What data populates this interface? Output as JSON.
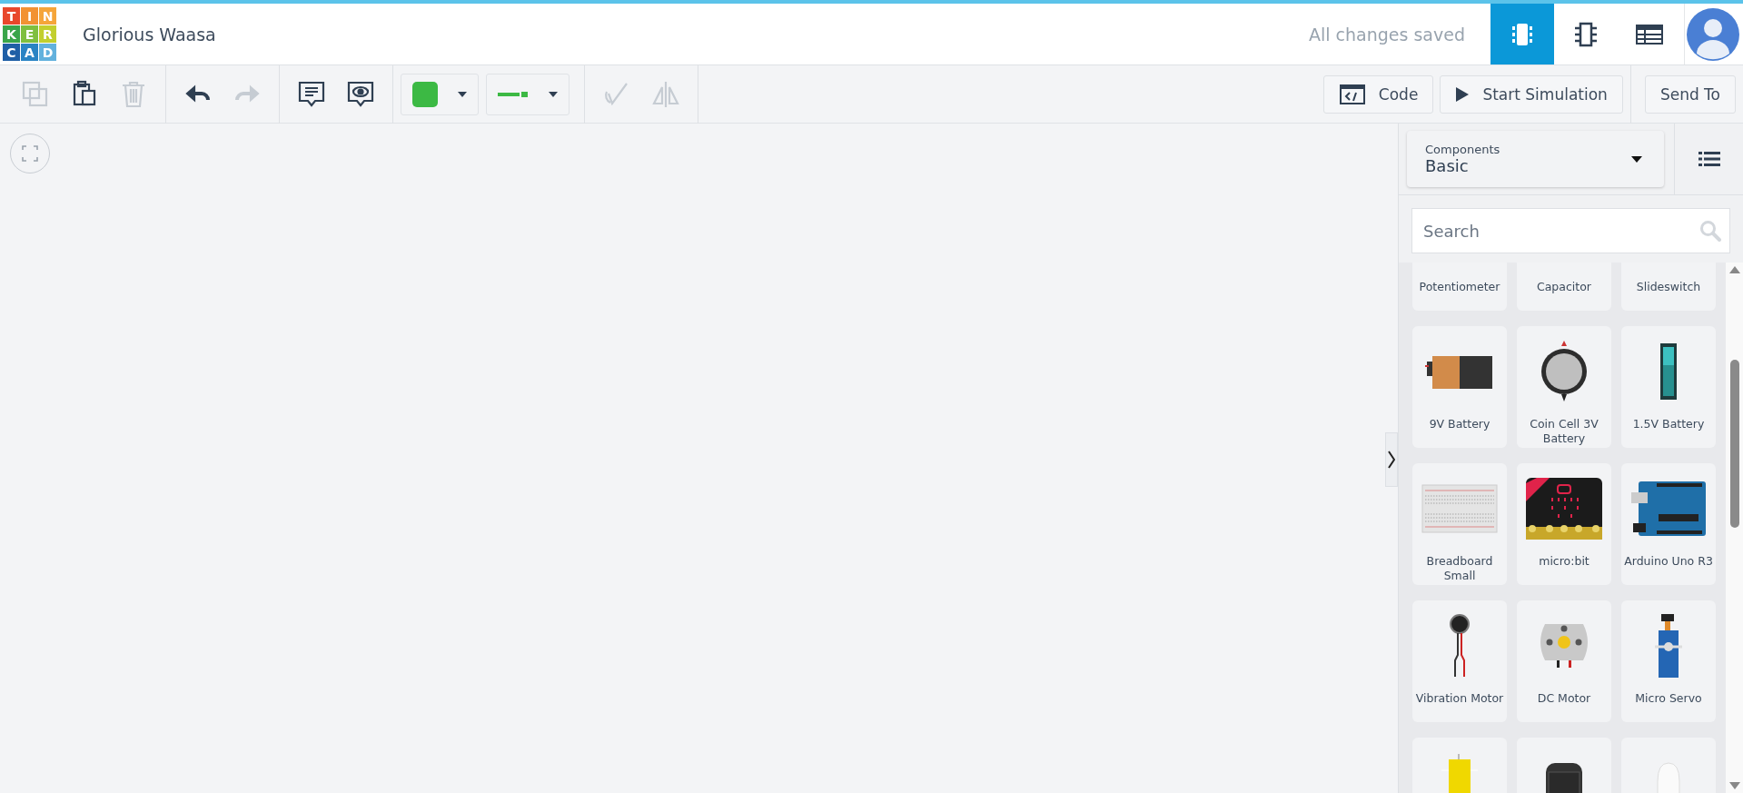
{
  "app": {
    "logo_letters": [
      "T",
      "I",
      "N",
      "K",
      "E",
      "R",
      "C",
      "A",
      "D"
    ],
    "project_title": "Glorious Waasa",
    "save_status": "All changes saved"
  },
  "view_tabs": [
    {
      "kind": "circuit",
      "selected": true
    },
    {
      "kind": "schematic",
      "selected": false
    },
    {
      "kind": "component-list",
      "selected": false
    }
  ],
  "toolbar": [
    {
      "kind": "copy",
      "disabled": true
    },
    {
      "kind": "paste",
      "disabled": false
    },
    {
      "kind": "delete",
      "disabled": true
    },
    {
      "kind": "undo",
      "disabled": false
    },
    {
      "kind": "redo",
      "disabled": true
    },
    {
      "kind": "notes",
      "disabled": false
    },
    {
      "kind": "notes-view",
      "disabled": false
    },
    {
      "kind": "color",
      "color": "#3cb944"
    },
    {
      "kind": "wire",
      "color": "#3cb944"
    },
    {
      "kind": "rotate",
      "disabled": true
    },
    {
      "kind": "flip",
      "disabled": true
    }
  ],
  "actions": [
    {
      "kind": "code",
      "label": "Code"
    },
    {
      "kind": "simulate",
      "label": "Start Simulation"
    },
    {
      "kind": "send",
      "label": "Send To"
    }
  ],
  "panel": {
    "dropdown_label": "Components",
    "dropdown_value": "Basic",
    "search": {
      "placeholder": "Search"
    },
    "items": [
      {
        "kind": "cut",
        "name": "Potentiometer"
      },
      {
        "kind": "cut",
        "name": "Capacitor"
      },
      {
        "kind": "cut",
        "name": "Slideswitch"
      },
      {
        "kind": "battery-9v",
        "name": "9V Battery"
      },
      {
        "kind": "coin-cell",
        "name": "Coin Cell 3V Battery"
      },
      {
        "kind": "battery-aa",
        "name": "1.5V Battery"
      },
      {
        "kind": "breadboard",
        "name": "Breadboard Small"
      },
      {
        "kind": "microbit",
        "name": "micro:bit"
      },
      {
        "kind": "arduino",
        "name": "Arduino Uno R3"
      },
      {
        "kind": "vibration-motor",
        "name": "Vibration Motor"
      },
      {
        "kind": "dc-motor",
        "name": "DC Motor"
      },
      {
        "kind": "servo",
        "name": "Micro Servo"
      },
      {
        "kind": "solar"
      },
      {
        "kind": "magnet"
      },
      {
        "kind": "bulb"
      }
    ]
  }
}
